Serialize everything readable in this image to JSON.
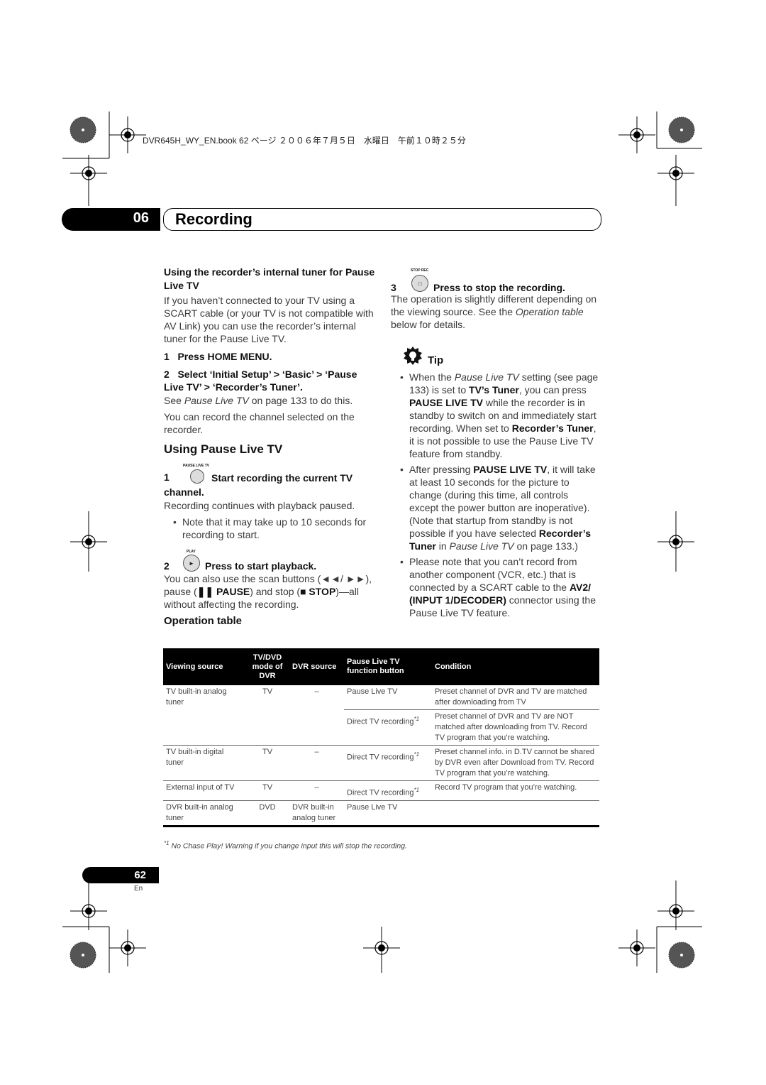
{
  "print_header": "DVR645H_WY_EN.book  62 ページ  ２００６年７月５日　水曜日　午前１０時２５分",
  "chapter": {
    "number": "06",
    "title": "Recording"
  },
  "left": {
    "heading1": "Using the recorder’s internal tuner for Pause Live TV",
    "intro": "If you haven’t connected to your TV using a SCART cable (or your TV is not compatible with AV Link) you can use the recorder’s internal tuner for the Pause Live TV.",
    "step1": {
      "num": "1",
      "text": "Press HOME MENU."
    },
    "step2": {
      "num": "2",
      "text": "Select ‘Initial Setup’ > ‘Basic’ > ‘Pause Live TV’ > ‘Recorder’s Tuner’."
    },
    "see_runs": [
      [
        "See ",
        ""
      ],
      [
        "Pause Live TV",
        "i"
      ],
      [
        " on page 133 to do this.",
        ""
      ]
    ],
    "record_note": "You can record the channel selected on the recorder.",
    "heading2": "Using Pause Live TV",
    "pl_step1": {
      "button_label": "PAUSE LIVE TV",
      "num": "1",
      "text": "Start recording the current TV channel.",
      "desc": "Recording continues with playback paused.",
      "bullet": "Note that it may take up to 10 seconds for recording to start."
    },
    "pl_step2": {
      "button_label": "PLAY",
      "button_glyph": "►",
      "num": "2",
      "text": "Press to start playback.",
      "desc_runs": [
        [
          "You can also use the scan buttons (◄◄/ ►►), pause (",
          ""
        ],
        [
          "❚❚ PAUSE",
          "b"
        ],
        [
          ") and stop (",
          ""
        ],
        [
          "■ STOP",
          "b"
        ],
        [
          ")—all without affecting the recording.",
          ""
        ]
      ]
    },
    "operation_table_heading": "Operation table"
  },
  "right": {
    "step3": {
      "button_label": "STOP REC",
      "button_glyph": "□",
      "num": "3",
      "text": "Press to stop the recording.",
      "desc_runs": [
        [
          "The operation is slightly different depending on the viewing source. See the ",
          ""
        ],
        [
          "Operation table",
          "i"
        ],
        [
          " below for details.",
          ""
        ]
      ]
    },
    "tip_label": "Tip",
    "tips": [
      [
        [
          "When the ",
          ""
        ],
        [
          "Pause Live TV",
          "i"
        ],
        [
          " setting (see page 133) is set to ",
          ""
        ],
        [
          "TV’s Tuner",
          "b"
        ],
        [
          ", you can press ",
          ""
        ],
        [
          "PAUSE LIVE TV",
          "b"
        ],
        [
          " while the recorder is in standby to switch on and immediately start recording. When set to ",
          ""
        ],
        [
          "Recorder’s Tuner",
          "b"
        ],
        [
          ", it is not possible to use the Pause Live TV feature from standby.",
          ""
        ]
      ],
      [
        [
          "After pressing ",
          ""
        ],
        [
          "PAUSE LIVE TV",
          "b"
        ],
        [
          ", it will take at least 10 seconds for the picture to change (during this time, all controls except the power button are inoperative). (Note that startup from standby is not possible if you have selected ",
          ""
        ],
        [
          "Recorder’s Tuner",
          "b"
        ],
        [
          " in ",
          ""
        ],
        [
          "Pause Live TV",
          "i"
        ],
        [
          " on page 133.)",
          ""
        ]
      ],
      [
        [
          "Please note that you can’t record from another component (VCR, etc.) that is connected by a SCART cable to the ",
          ""
        ],
        [
          "AV2/ (INPUT 1/DECODER)",
          "b"
        ],
        [
          " connector using the Pause Live TV feature.",
          ""
        ]
      ]
    ]
  },
  "table": {
    "headers": [
      "Viewing source",
      "TV/DVD mode of DVR",
      "DVR source",
      "Pause Live TV function button",
      "Condition"
    ],
    "rows": [
      {
        "source": "TV built-in analog tuner",
        "mode": "TV",
        "dvr_source": "–",
        "button": "Pause Live TV",
        "sup": "",
        "condition": "Preset channel of DVR and TV are matched after downloading from TV"
      },
      {
        "source": "",
        "mode": "",
        "dvr_source": "",
        "button": "Direct TV recording",
        "sup": "*1",
        "condition": "Preset channel of DVR and TV are NOT matched after downloading from TV. Record TV program that you’re watching."
      },
      {
        "source": "TV built-in digital tuner",
        "mode": "TV",
        "dvr_source": "–",
        "button": "Direct TV recording",
        "sup": "*1",
        "condition": "Preset channel info. in D.TV cannot be shared by DVR even after Download from TV. Record TV program that you’re watching."
      },
      {
        "source": "External input of TV",
        "mode": "TV",
        "dvr_source": "–",
        "button": "Direct TV recording",
        "sup": "*1",
        "condition": "Record TV program that you’re watching."
      },
      {
        "source": "DVR built-in analog tuner",
        "mode": "DVD",
        "dvr_source": "DVR built-in analog tuner",
        "button": "Pause Live TV",
        "sup": "",
        "condition": ""
      }
    ],
    "footnote_mark": "*1",
    "footnote": "No Chase Play! Warning if you change input this will stop the recording."
  },
  "footer": {
    "page_number": "62",
    "language": "En"
  }
}
